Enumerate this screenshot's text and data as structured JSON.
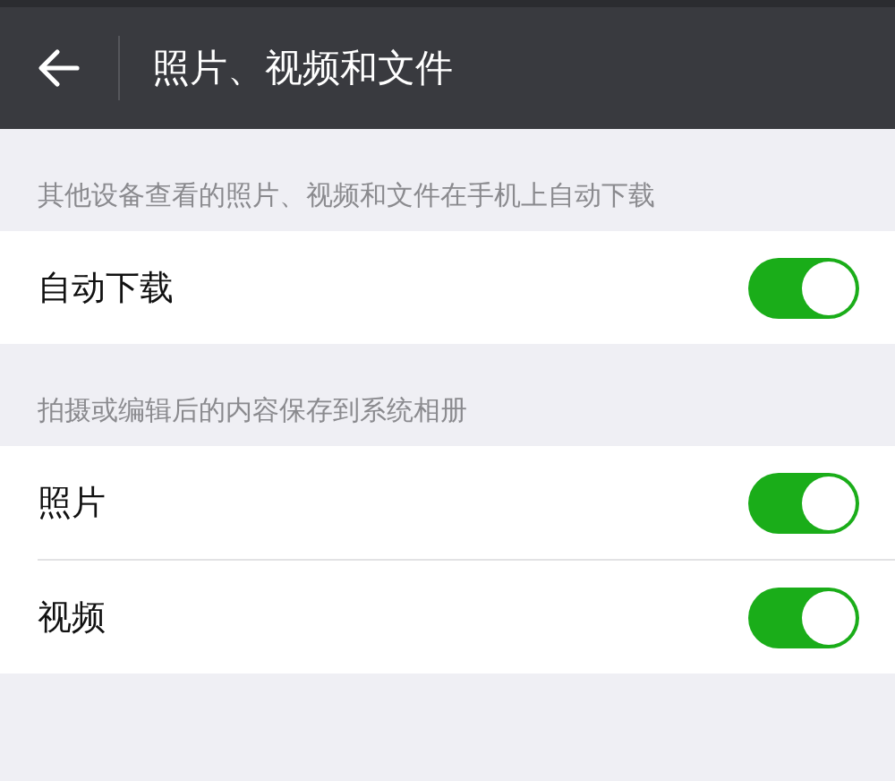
{
  "header": {
    "title": "照片、视频和文件"
  },
  "sections": [
    {
      "caption": "其他设备查看的照片、视频和文件在手机上自动下载",
      "rows": [
        {
          "label": "自动下载",
          "on": true
        }
      ]
    },
    {
      "caption": "拍摄或编辑后的内容保存到系统相册",
      "rows": [
        {
          "label": "照片",
          "on": true
        },
        {
          "label": "视频",
          "on": true
        }
      ]
    }
  ]
}
